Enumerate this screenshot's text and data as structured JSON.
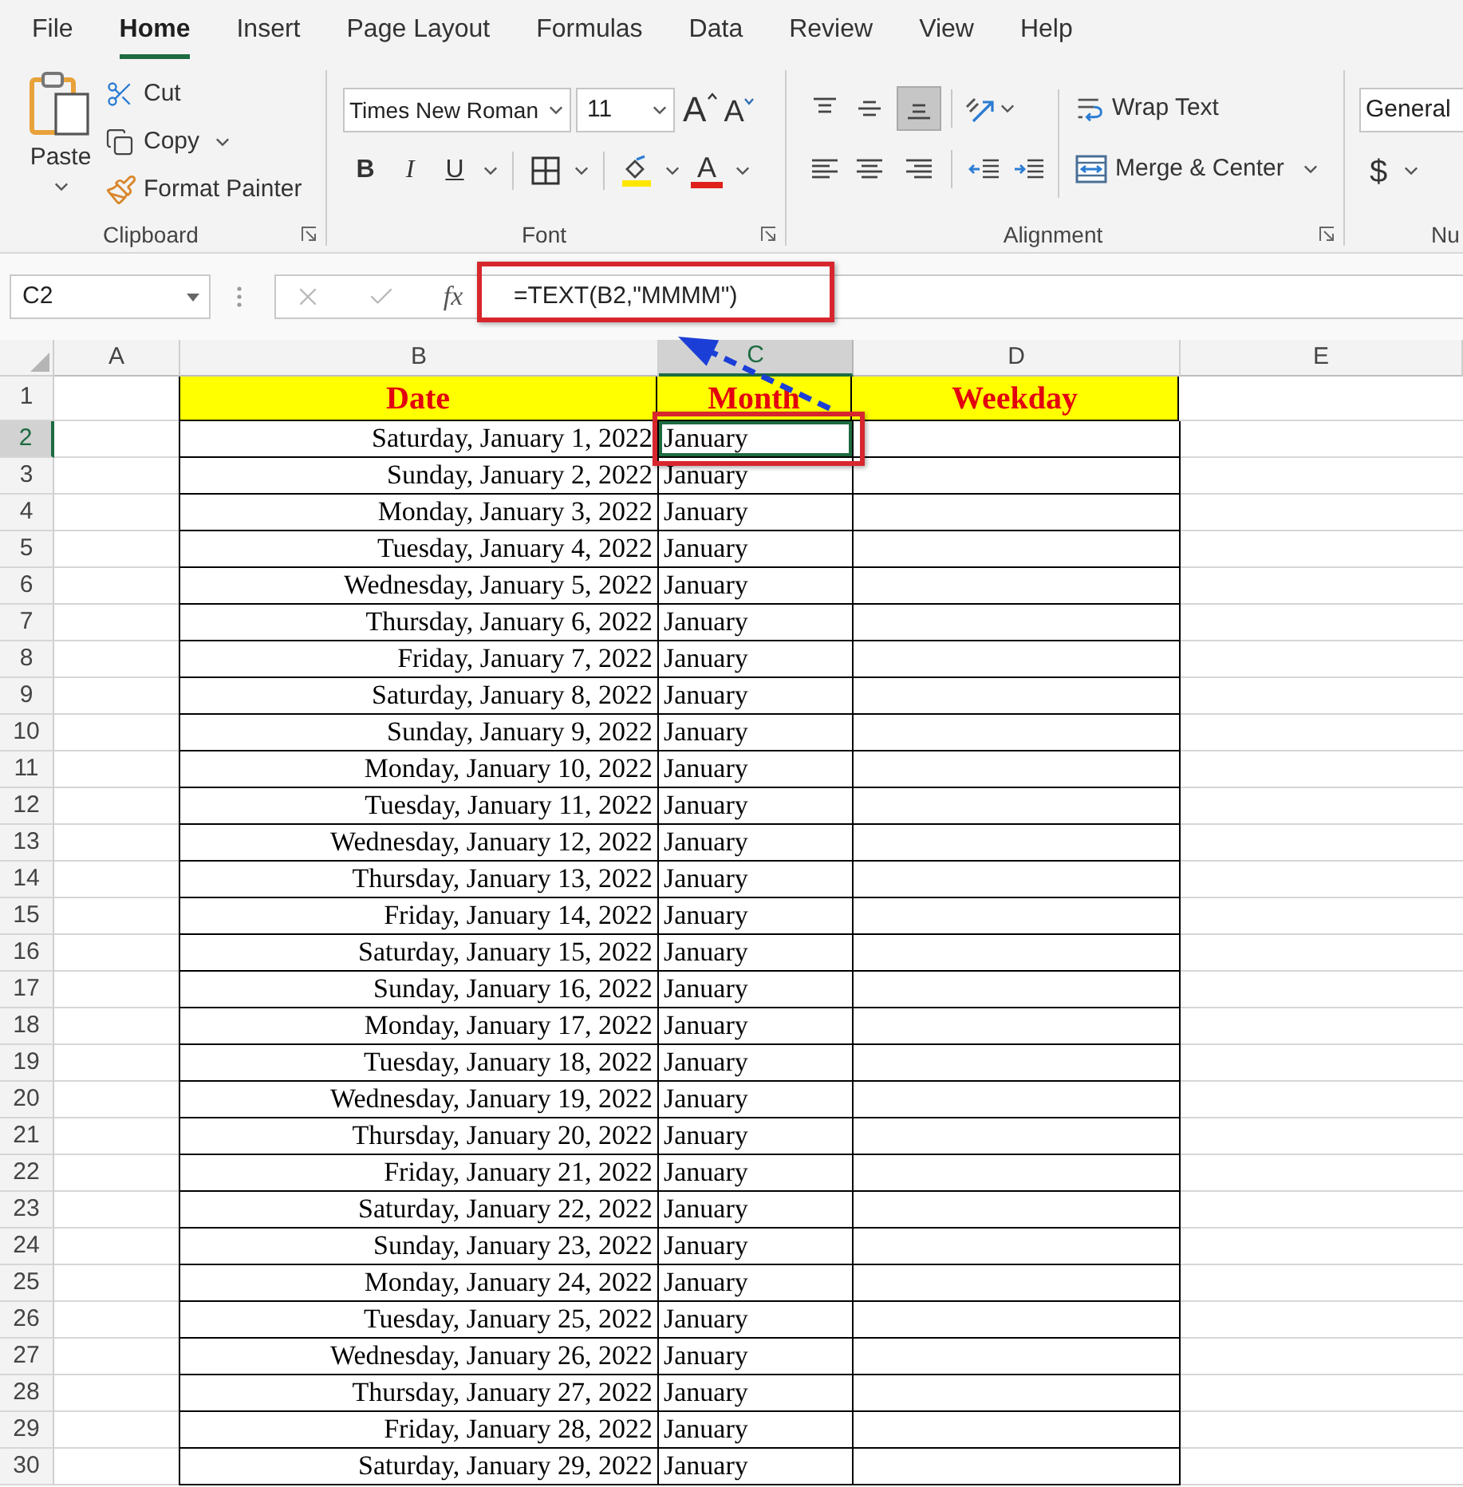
{
  "ribbon_tabs": [
    {
      "label": "File",
      "selected": false
    },
    {
      "label": "Home",
      "selected": true
    },
    {
      "label": "Insert",
      "selected": false
    },
    {
      "label": "Page Layout",
      "selected": false
    },
    {
      "label": "Formulas",
      "selected": false
    },
    {
      "label": "Data",
      "selected": false
    },
    {
      "label": "Review",
      "selected": false
    },
    {
      "label": "View",
      "selected": false
    },
    {
      "label": "Help",
      "selected": false
    }
  ],
  "clipboard": {
    "paste": "Paste",
    "cut": "Cut",
    "copy": "Copy",
    "format_painter": "Format Painter",
    "label": "Clipboard"
  },
  "font": {
    "name": "Times New Roman",
    "size": "11",
    "grow": "A",
    "shrink": "A",
    "bold": "B",
    "italic": "I",
    "underline": "U",
    "font_color": "A",
    "label": "Font"
  },
  "alignment": {
    "vertical": [
      {
        "kind": "top",
        "selected": false
      },
      {
        "kind": "middle",
        "selected": false
      },
      {
        "kind": "bottom",
        "selected": true
      }
    ],
    "horizontal": [
      {
        "kind": "left",
        "selected": false
      },
      {
        "kind": "center",
        "selected": false
      },
      {
        "kind": "right",
        "selected": false
      }
    ],
    "wrap_text": "Wrap Text",
    "merge_center": "Merge & Center",
    "label": "Alignment"
  },
  "number": {
    "format": "General",
    "currency": "$",
    "label": "Nu"
  },
  "formula_bar": {
    "name_box": "C2",
    "function_label": "fx",
    "formula": "=TEXT(B2,\"MMMM\")"
  },
  "sheet": {
    "columns": [
      {
        "label": "A",
        "selected": false
      },
      {
        "label": "B",
        "selected": false
      },
      {
        "label": "C",
        "selected": true
      },
      {
        "label": "D",
        "selected": false
      },
      {
        "label": "E",
        "selected": false
      }
    ],
    "header_row": {
      "number": "1",
      "cells": [
        "Date",
        "Month",
        "Weekday"
      ]
    },
    "rows": [
      {
        "number": "2",
        "date": "Saturday, January 1, 2022",
        "month": "January",
        "selected": true
      },
      {
        "number": "3",
        "date": "Sunday, January 2, 2022",
        "month": "January",
        "selected": false
      },
      {
        "number": "4",
        "date": "Monday, January 3, 2022",
        "month": "January",
        "selected": false
      },
      {
        "number": "5",
        "date": "Tuesday, January 4, 2022",
        "month": "January",
        "selected": false
      },
      {
        "number": "6",
        "date": "Wednesday, January 5, 2022",
        "month": "January",
        "selected": false
      },
      {
        "number": "7",
        "date": "Thursday, January 6, 2022",
        "month": "January",
        "selected": false
      },
      {
        "number": "8",
        "date": "Friday, January 7, 2022",
        "month": "January",
        "selected": false
      },
      {
        "number": "9",
        "date": "Saturday, January 8, 2022",
        "month": "January",
        "selected": false
      },
      {
        "number": "10",
        "date": "Sunday, January 9, 2022",
        "month": "January",
        "selected": false
      },
      {
        "number": "11",
        "date": "Monday, January 10, 2022",
        "month": "January",
        "selected": false
      },
      {
        "number": "12",
        "date": "Tuesday, January 11, 2022",
        "month": "January",
        "selected": false
      },
      {
        "number": "13",
        "date": "Wednesday, January 12, 2022",
        "month": "January",
        "selected": false
      },
      {
        "number": "14",
        "date": "Thursday, January 13, 2022",
        "month": "January",
        "selected": false
      },
      {
        "number": "15",
        "date": "Friday, January 14, 2022",
        "month": "January",
        "selected": false
      },
      {
        "number": "16",
        "date": "Saturday, January 15, 2022",
        "month": "January",
        "selected": false
      },
      {
        "number": "17",
        "date": "Sunday, January 16, 2022",
        "month": "January",
        "selected": false
      },
      {
        "number": "18",
        "date": "Monday, January 17, 2022",
        "month": "January",
        "selected": false
      },
      {
        "number": "19",
        "date": "Tuesday, January 18, 2022",
        "month": "January",
        "selected": false
      },
      {
        "number": "20",
        "date": "Wednesday, January 19, 2022",
        "month": "January",
        "selected": false
      },
      {
        "number": "21",
        "date": "Thursday, January 20, 2022",
        "month": "January",
        "selected": false
      },
      {
        "number": "22",
        "date": "Friday, January 21, 2022",
        "month": "January",
        "selected": false
      },
      {
        "number": "23",
        "date": "Saturday, January 22, 2022",
        "month": "January",
        "selected": false
      },
      {
        "number": "24",
        "date": "Sunday, January 23, 2022",
        "month": "January",
        "selected": false
      },
      {
        "number": "25",
        "date": "Monday, January 24, 2022",
        "month": "January",
        "selected": false
      },
      {
        "number": "26",
        "date": "Tuesday, January 25, 2022",
        "month": "January",
        "selected": false
      },
      {
        "number": "27",
        "date": "Wednesday, January 26, 2022",
        "month": "January",
        "selected": false
      },
      {
        "number": "28",
        "date": "Thursday, January 27, 2022",
        "month": "January",
        "selected": false
      },
      {
        "number": "29",
        "date": "Friday, January 28, 2022",
        "month": "January",
        "selected": false
      },
      {
        "number": "30",
        "date": "Saturday, January 29, 2022",
        "month": "January",
        "selected": false
      }
    ]
  },
  "annotations": [
    {
      "kind": "formula_box"
    },
    {
      "kind": "cell_box"
    },
    {
      "kind": "arrow"
    }
  ]
}
